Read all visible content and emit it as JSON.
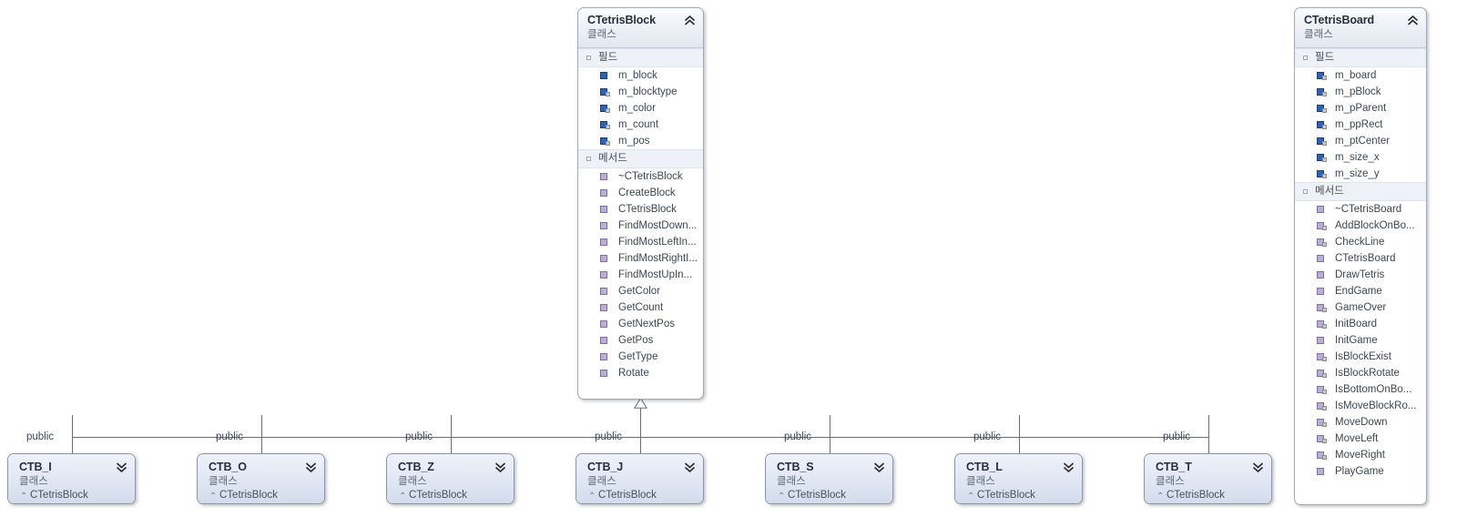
{
  "diagram": {
    "stereotype_class": "클래스",
    "section_fields": "필드",
    "section_methods": "메서드",
    "edge_label_public": "public",
    "colors": {
      "field_icon": "#2f62b4",
      "method_icon": "#b9aed6",
      "header_gradient_top": "#fbfcfe",
      "header_gradient_bottom": "#e2e7f0",
      "section_header_bg": "#eef1f8",
      "border": "#9fa8b4",
      "connector": "#6d6d6d"
    }
  },
  "base_class": {
    "name": "CTetrisBlock",
    "stereotype": "클래스",
    "collapse_icon": "chevron-up-icon",
    "fields_label": "필드",
    "fields": [
      {
        "name": "m_block",
        "icon": "field-icon",
        "access": "public"
      },
      {
        "name": "m_blocktype",
        "icon": "field-icon",
        "access": "private"
      },
      {
        "name": "m_color",
        "icon": "field-icon",
        "access": "private"
      },
      {
        "name": "m_count",
        "icon": "field-icon",
        "access": "private"
      },
      {
        "name": "m_pos",
        "icon": "field-icon",
        "access": "private"
      }
    ],
    "methods_label": "메서드",
    "methods": [
      {
        "name": "~CTetrisBlock",
        "icon": "method-icon",
        "access": "public"
      },
      {
        "name": "CreateBlock",
        "icon": "method-icon",
        "access": "public"
      },
      {
        "name": "CTetrisBlock",
        "icon": "method-icon",
        "access": "public"
      },
      {
        "name": "FindMostDown...",
        "icon": "method-icon",
        "access": "public"
      },
      {
        "name": "FindMostLeftIn...",
        "icon": "method-icon",
        "access": "public"
      },
      {
        "name": "FindMostRightI...",
        "icon": "method-icon",
        "access": "public"
      },
      {
        "name": "FindMostUpIn...",
        "icon": "method-icon",
        "access": "public"
      },
      {
        "name": "GetColor",
        "icon": "method-icon",
        "access": "public"
      },
      {
        "name": "GetCount",
        "icon": "method-icon",
        "access": "public"
      },
      {
        "name": "GetNextPos",
        "icon": "method-icon",
        "access": "public"
      },
      {
        "name": "GetPos",
        "icon": "method-icon",
        "access": "public"
      },
      {
        "name": "GetType",
        "icon": "method-icon",
        "access": "public"
      },
      {
        "name": "Rotate",
        "icon": "method-icon",
        "access": "public"
      }
    ]
  },
  "board_class": {
    "name": "CTetrisBoard",
    "stereotype": "클래스",
    "collapse_icon": "chevron-up-icon",
    "fields_label": "필드",
    "fields": [
      {
        "name": "m_board",
        "icon": "field-icon",
        "access": "private"
      },
      {
        "name": "m_pBlock",
        "icon": "field-icon",
        "access": "private"
      },
      {
        "name": "m_pParent",
        "icon": "field-icon",
        "access": "private"
      },
      {
        "name": "m_ppRect",
        "icon": "field-icon",
        "access": "private"
      },
      {
        "name": "m_ptCenter",
        "icon": "field-icon",
        "access": "private"
      },
      {
        "name": "m_size_x",
        "icon": "field-icon",
        "access": "private"
      },
      {
        "name": "m_size_y",
        "icon": "field-icon",
        "access": "private"
      }
    ],
    "methods_label": "메서드",
    "methods": [
      {
        "name": "~CTetrisBoard",
        "icon": "method-icon",
        "access": "public"
      },
      {
        "name": "AddBlockOnBo...",
        "icon": "method-icon",
        "access": "private"
      },
      {
        "name": "CheckLine",
        "icon": "method-icon",
        "access": "private"
      },
      {
        "name": "CTetrisBoard",
        "icon": "method-icon",
        "access": "public"
      },
      {
        "name": "DrawTetris",
        "icon": "method-icon",
        "access": "public"
      },
      {
        "name": "EndGame",
        "icon": "method-icon",
        "access": "public"
      },
      {
        "name": "GameOver",
        "icon": "method-icon",
        "access": "private"
      },
      {
        "name": "InitBoard",
        "icon": "method-icon",
        "access": "private"
      },
      {
        "name": "InitGame",
        "icon": "method-icon",
        "access": "public"
      },
      {
        "name": "IsBlockExist",
        "icon": "method-icon",
        "access": "private"
      },
      {
        "name": "IsBlockRotate",
        "icon": "method-icon",
        "access": "private"
      },
      {
        "name": "IsBottomOnBo...",
        "icon": "method-icon",
        "access": "private"
      },
      {
        "name": "IsMoveBlockRo...",
        "icon": "method-icon",
        "access": "private"
      },
      {
        "name": "MoveDown",
        "icon": "method-icon",
        "access": "private"
      },
      {
        "name": "MoveLeft",
        "icon": "method-icon",
        "access": "private"
      },
      {
        "name": "MoveRight",
        "icon": "method-icon",
        "access": "private"
      },
      {
        "name": "PlayGame",
        "icon": "method-icon",
        "access": "public"
      }
    ]
  },
  "derived_classes": [
    {
      "name": "CTB_I",
      "stereotype": "클래스",
      "base": "CTetrisBlock",
      "edge_label": "public",
      "collapse_icon": "chevron-down-icon"
    },
    {
      "name": "CTB_O",
      "stereotype": "클래스",
      "base": "CTetrisBlock",
      "edge_label": "public",
      "collapse_icon": "chevron-down-icon"
    },
    {
      "name": "CTB_Z",
      "stereotype": "클래스",
      "base": "CTetrisBlock",
      "edge_label": "public",
      "collapse_icon": "chevron-down-icon"
    },
    {
      "name": "CTB_J",
      "stereotype": "클래스",
      "base": "CTetrisBlock",
      "edge_label": "public",
      "collapse_icon": "chevron-down-icon"
    },
    {
      "name": "CTB_S",
      "stereotype": "클래스",
      "base": "CTetrisBlock",
      "edge_label": "public",
      "collapse_icon": "chevron-down-icon"
    },
    {
      "name": "CTB_L",
      "stereotype": "클래스",
      "base": "CTetrisBlock",
      "edge_label": "public",
      "collapse_icon": "chevron-down-icon"
    },
    {
      "name": "CTB_T",
      "stereotype": "클래스",
      "base": "CTetrisBlock",
      "edge_label": "public",
      "collapse_icon": "chevron-down-icon"
    }
  ]
}
